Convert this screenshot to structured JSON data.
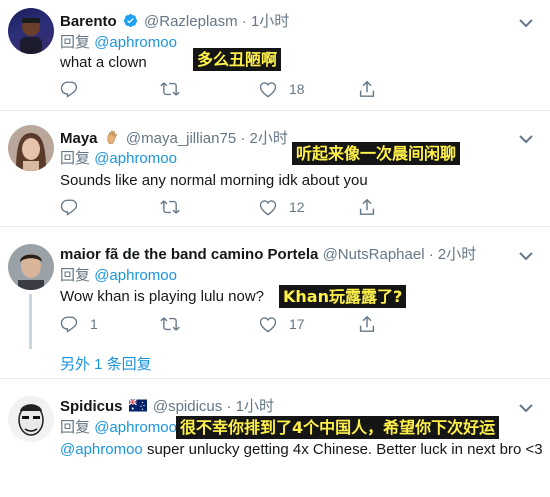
{
  "tweets": [
    {
      "name": "Barento",
      "handle": "@Razleplasm",
      "time": "1小时",
      "reply_prefix": "回复",
      "reply_to": "@aphromoo",
      "text": "what a clown",
      "translation": "多么丑陋啊",
      "replies": "",
      "retweets": "",
      "likes": "18"
    },
    {
      "name": "Maya",
      "handle": "@maya_jillian75",
      "time": "2小时",
      "reply_prefix": "回复",
      "reply_to": "@aphromoo",
      "text": "Sounds like any normal morning idk about you",
      "translation": "听起来像一次晨间闲聊",
      "replies": "",
      "retweets": "",
      "likes": "12"
    },
    {
      "name": "maior fã de the band camino Portela",
      "handle": "@NutsRaphael",
      "time": "2小时",
      "reply_prefix": "回复",
      "reply_to": "@aphromoo",
      "text": "Wow khan is playing lulu now?",
      "translation": "Khan玩露露了?",
      "replies": "1",
      "retweets": "",
      "likes": "17",
      "more_replies": "另外 1 条回复"
    },
    {
      "name": "Spidicus",
      "handle": "@spidicus",
      "time": "1小时",
      "reply_prefix": "回复",
      "reply_to": "@aphromoo",
      "text_mention": "@aphromoo",
      "text": " super unlucky getting 4x Chinese. Better luck in next bro <3",
      "translation": "很不幸你排到了4个中国人，希望你下次好运"
    }
  ],
  "separator_dot": "·",
  "colors": {
    "link": "#1b95e0",
    "muted": "#657786",
    "annotation_bg": "#151515",
    "annotation_fg": "#fff14a"
  },
  "icons": [
    "verified-badge-icon",
    "reply-icon",
    "retweet-icon",
    "like-icon",
    "share-icon",
    "chevron-down-icon",
    "hand-emoji-icon",
    "australia-flag-icon"
  ]
}
